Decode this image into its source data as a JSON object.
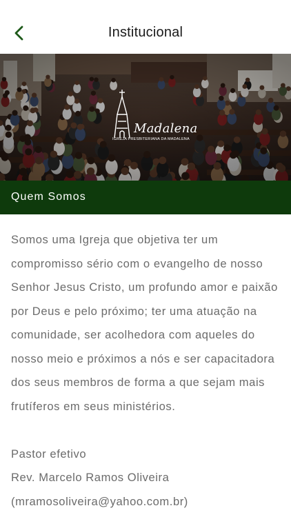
{
  "header": {
    "title": "Institucional",
    "back_icon": "chevron-left-icon"
  },
  "banner": {
    "logo_word": "Madalena",
    "logo_subtitle": "IGREJA PRESBITERIANA DA MADALENA"
  },
  "section": {
    "title": "Quem Somos"
  },
  "content": {
    "description": "Somos uma Igreja que objetiva ter um compromisso sério com o evangelho de nosso Senhor Jesus Cristo, um profundo amor e paixão por Deus e pelo próximo; ter uma atuação na comunidade, ser acolhedora com aqueles do nosso meio e próximos a nós e ser capacitadora dos seus membros de forma a que sejam mais frutíferos em seus ministérios.",
    "pastor_label": "Pastor efetivo",
    "pastor_name": "Rev. Marcelo Ramos Oliveira",
    "pastor_email": "(mramosoliveira@yahoo.com.br)"
  },
  "colors": {
    "accent_green": "#0e3a0c",
    "back_icon_green": "#1e5a1a",
    "body_text": "#6b6b6b"
  }
}
